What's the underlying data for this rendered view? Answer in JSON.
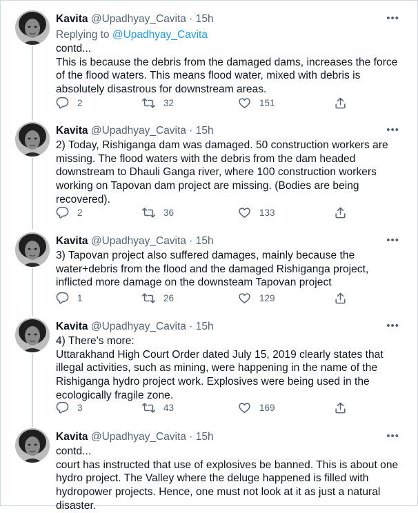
{
  "tweets": [
    {
      "name": "Kavita",
      "handle": "@Upadhyay_Cavita",
      "time": "15h",
      "replying_label": "Replying to",
      "replying_to": "@Upadhyay_Cavita",
      "text": "contd...\nThis is because the debris from the damaged dams, increases the force of the flood waters. This means flood water, mixed with debris is absolutely disastrous for downstream areas.",
      "replies": "2",
      "retweets": "32",
      "likes": "151"
    },
    {
      "name": "Kavita",
      "handle": "@Upadhyay_Cavita",
      "time": "15h",
      "text": "2) Today, Rishiganga dam was damaged. 50 construction workers are missing. The flood waters with the debris from the dam headed downstream to Dhauli Ganga river, where 100 construction workers working on Tapovan dam project are missing. (Bodies are being recovered).",
      "replies": "2",
      "retweets": "36",
      "likes": "133"
    },
    {
      "name": "Kavita",
      "handle": "@Upadhyay_Cavita",
      "time": "15h",
      "text": "3) Tapovan project also suffered damages, mainly because the water+debris from the flood and the damaged Rishiganga project, inflicted more damage on the downsteam Tapovan project",
      "replies": "1",
      "retweets": "26",
      "likes": "129"
    },
    {
      "name": "Kavita",
      "handle": "@Upadhyay_Cavita",
      "time": "15h",
      "text": "4) There's more:\nUttarakhand High Court Order dated July 15, 2019 clearly states that illegal activities, such as mining, were happening in the name of the Rishiganga hydro project work. Explosives were being used in the ecologically fragile zone.",
      "replies": "3",
      "retweets": "43",
      "likes": "169"
    },
    {
      "name": "Kavita",
      "handle": "@Upadhyay_Cavita",
      "time": "15h",
      "text": "contd...\ncourt has instructed that use of explosives be banned. This is about one hydro project. The Valley where the deluge happened is filled with hydropower projects. Hence, one must not look at it as just a natural disaster."
    }
  ],
  "separator": "·",
  "more_glyph": "•••",
  "icons": {
    "reply": "reply-icon",
    "retweet": "retweet-icon",
    "like": "heart-icon",
    "share": "share-icon",
    "more": "more-icon"
  },
  "colors": {
    "text": "#0f1419",
    "muted": "#536471",
    "link": "#1d9bf0",
    "thread_line": "#cfd9de"
  }
}
